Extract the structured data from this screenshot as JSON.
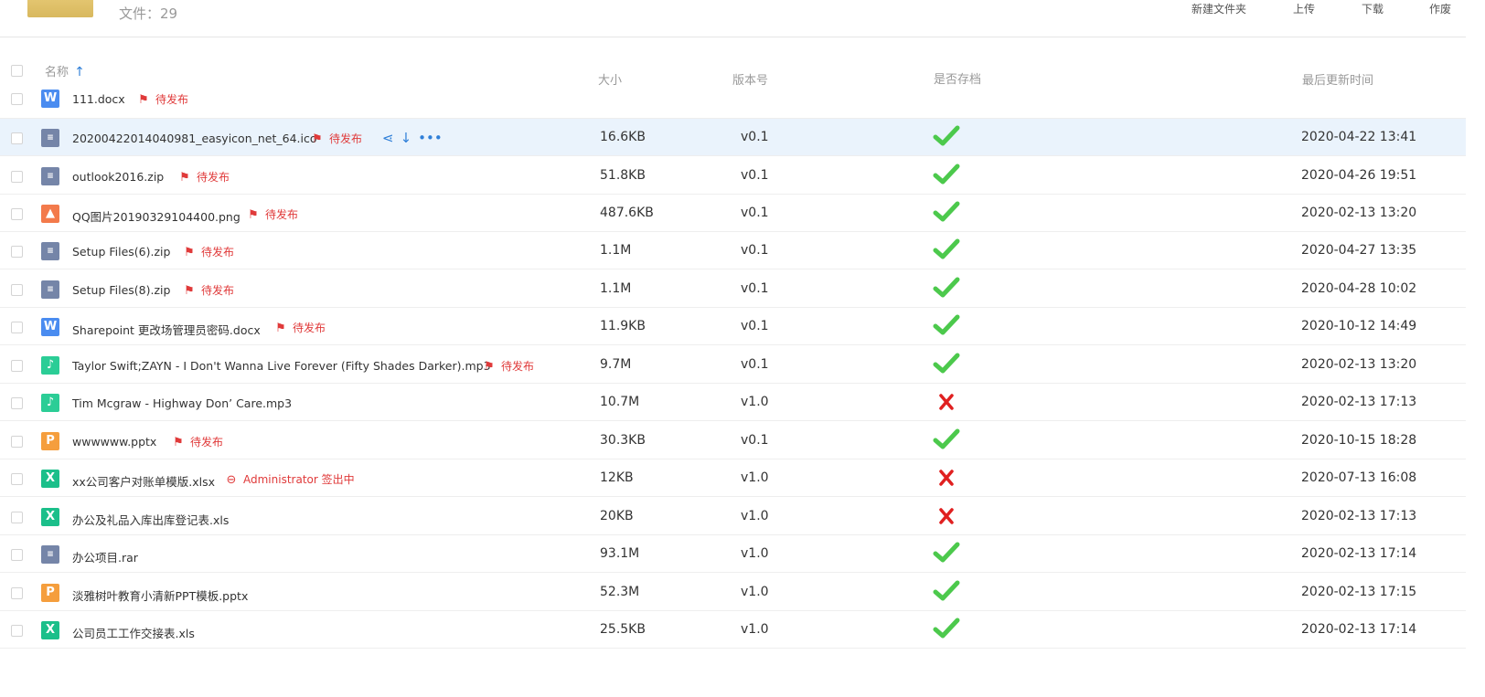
{
  "folder": {
    "file_count": "文件：29"
  },
  "toolbar": {
    "new_folder": "新建文件夹",
    "upload": "上传",
    "download": "下载",
    "void": "作废"
  },
  "columns": {
    "name": "名称",
    "sort_icon": "arrow-up-icon",
    "size": "大小",
    "version": "版本号",
    "archived": "是否存档",
    "updated": "最后更新时间"
  },
  "colors": {
    "accent": "#2f7fd8",
    "status_red": "#e03a3a",
    "check_green": "#4cc94c",
    "cross_red": "#e02020",
    "highlight_row": "#eaf3fc"
  },
  "files": [
    {
      "icon": "word",
      "icon_label": "W",
      "name": "111.docx",
      "status": "待发布",
      "status_icon": "stamp-icon",
      "size": "",
      "version": "",
      "archived": null,
      "updated": ""
    },
    {
      "icon": "archive",
      "icon_label": "≡",
      "name": "20200422014040981_easyicon_net_64.ico",
      "status": "待发布",
      "status_icon": "stamp-icon",
      "size": "16.6KB",
      "version": "v0.1",
      "archived": true,
      "updated": "2020-04-22 13:41",
      "highlighted": true
    },
    {
      "icon": "archive",
      "icon_label": "≡",
      "name": "outlook2016.zip",
      "status": "待发布",
      "status_icon": "stamp-icon",
      "size": "51.8KB",
      "version": "v0.1",
      "archived": true,
      "updated": "2020-04-26 19:51"
    },
    {
      "icon": "image",
      "icon_label": "▲",
      "name": "QQ图片20190329104400.png",
      "status": "待发布",
      "status_icon": "stamp-icon",
      "size": "487.6KB",
      "version": "v0.1",
      "archived": true,
      "updated": "2020-02-13 13:20"
    },
    {
      "icon": "archive",
      "icon_label": "≡",
      "name": "Setup Files(6).zip",
      "status": "待发布",
      "status_icon": "stamp-icon",
      "size": "1.1M",
      "version": "v0.1",
      "archived": true,
      "updated": "2020-04-27 13:35"
    },
    {
      "icon": "archive",
      "icon_label": "≡",
      "name": "Setup Files(8).zip",
      "status": "待发布",
      "status_icon": "stamp-icon",
      "size": "1.1M",
      "version": "v0.1",
      "archived": true,
      "updated": "2020-04-28 10:02"
    },
    {
      "icon": "word",
      "icon_label": "W",
      "name": "Sharepoint 更改场管理员密码.docx",
      "status": "待发布",
      "status_icon": "stamp-icon",
      "size": "11.9KB",
      "version": "v0.1",
      "archived": true,
      "updated": "2020-10-12 14:49"
    },
    {
      "icon": "music",
      "icon_label": "♪",
      "name": "Taylor Swift;ZAYN - I Don't Wanna Live Forever (Fifty Shades Darker).mp3",
      "status": "待发布",
      "status_icon": "stamp-icon",
      "size": "9.7M",
      "version": "v0.1",
      "archived": true,
      "updated": "2020-02-13 13:20"
    },
    {
      "icon": "music",
      "icon_label": "♪",
      "name": "Tim Mcgraw - Highway Don’ Care.mp3",
      "status": "",
      "status_icon": "",
      "size": "10.7M",
      "version": "v1.0",
      "archived": false,
      "updated": "2020-02-13 17:13"
    },
    {
      "icon": "ppt",
      "icon_label": "P",
      "name": "wwwwww.pptx",
      "status": "待发布",
      "status_icon": "stamp-icon",
      "size": "30.3KB",
      "version": "v0.1",
      "archived": true,
      "updated": "2020-10-15 18:28"
    },
    {
      "icon": "excel",
      "icon_label": "X",
      "name": "xx公司客户对账单模版.xlsx",
      "status": "Administrator  签出中",
      "status_icon": "checkout-icon",
      "size": "12KB",
      "version": "v1.0",
      "archived": false,
      "updated": "2020-07-13 16:08"
    },
    {
      "icon": "excel",
      "icon_label": "X",
      "name": "办公及礼品入库出库登记表.xls",
      "status": "",
      "status_icon": "",
      "size": "20KB",
      "version": "v1.0",
      "archived": false,
      "updated": "2020-02-13 17:13"
    },
    {
      "icon": "archive",
      "icon_label": "≡",
      "name": "办公项目.rar",
      "status": "",
      "status_icon": "",
      "size": "93.1M",
      "version": "v1.0",
      "archived": true,
      "updated": "2020-02-13 17:14"
    },
    {
      "icon": "ppt",
      "icon_label": "P",
      "name": "淡雅树叶教育小清新PPT模板.pptx",
      "status": "",
      "status_icon": "",
      "size": "52.3M",
      "version": "v1.0",
      "archived": true,
      "updated": "2020-02-13 17:15"
    },
    {
      "icon": "excel",
      "icon_label": "X",
      "name": "公司员工工作交接表.xls",
      "status": "",
      "status_icon": "",
      "size": "25.5KB",
      "version": "v1.0",
      "archived": true,
      "updated": "2020-02-13 17:14"
    }
  ]
}
